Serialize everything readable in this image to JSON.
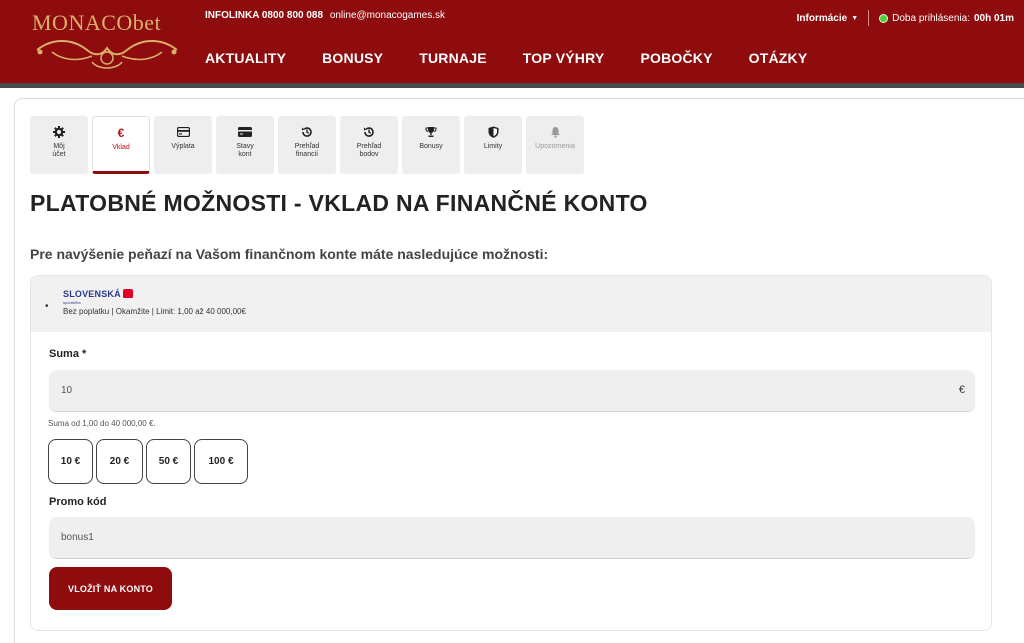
{
  "header": {
    "logo_text": "MONACObet",
    "infoline_label": "INFOLINKA",
    "phone": "0800 800 088",
    "email": "online@monacogames.sk",
    "info_menu": "Informácie",
    "session_label": "Doba prihlásenia:",
    "session_time": "00h 01m",
    "nav": [
      {
        "label": "AKTUALITY"
      },
      {
        "label": "BONUSY"
      },
      {
        "label": "TURNAJE"
      },
      {
        "label": "TOP VÝHRY"
      },
      {
        "label": "POBOČKY"
      },
      {
        "label": "OTÁZKY"
      }
    ],
    "colors": {
      "brand": "#8e0b0e",
      "status": "#4cd137",
      "logo": "#d8b06a"
    }
  },
  "tabs": [
    {
      "label": "Môj\núčet",
      "icon": "gear-icon"
    },
    {
      "label": "Vklad",
      "icon": "euro-icon",
      "active": true
    },
    {
      "label": "Výplata",
      "icon": "card-icon"
    },
    {
      "label": "Stavy\nkont",
      "icon": "wallet-icon"
    },
    {
      "label": "Prehľad\nfinancií",
      "icon": "history-icon"
    },
    {
      "label": "Prehľad\nbodov",
      "icon": "history-icon"
    },
    {
      "label": "Bonusy",
      "icon": "trophy-icon"
    },
    {
      "label": "Limity",
      "icon": "shield-icon"
    },
    {
      "label": "Upozornenia",
      "icon": "bell-icon",
      "disabled": true
    }
  ],
  "page_title": "PLATOBNÉ MOŽNOSTI - VKLAD NA FINANČNÉ KONTO",
  "subtitle": "Pre navýšenie peňazí na Vašom finančnom konte máte nasledujúce možnosti:",
  "method": {
    "bank_name": "SLOVENSKÁ",
    "bank_sub": "sporiteľňa",
    "description": "Bez poplatku | Okamžite | Limit: 1,00 až 40 000,00€"
  },
  "form": {
    "amount_label": "Suma *",
    "amount_value": "10",
    "currency": "€",
    "amount_hint": "Suma od 1,00 do 40 000,00 €.",
    "quick_amounts": [
      "10 €",
      "20 €",
      "50 €",
      "100 €"
    ],
    "promo_label": "Promo kód",
    "promo_value": "bonus1",
    "submit_label": "VLOŽIŤ NA KONTO"
  }
}
